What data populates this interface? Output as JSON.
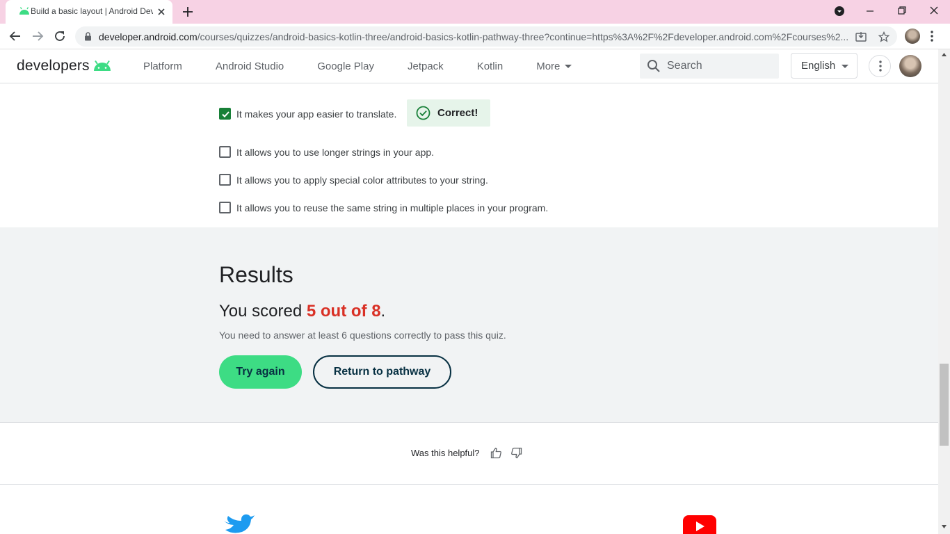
{
  "browser": {
    "tab_title": "Build a basic layout  |  Android Developers",
    "url_host": "developer.android.com",
    "url_path": "/courses/quizzes/android-basics-kotlin-three/android-basics-kotlin-pathway-three?continue=https%3A%2F%2Fdeveloper.android.com%2Fcourses%2..."
  },
  "header": {
    "logo_text": "developers",
    "nav": [
      "Platform",
      "Android Studio",
      "Google Play",
      "Jetpack",
      "Kotlin",
      "More"
    ],
    "search_placeholder": "Search",
    "language": "English"
  },
  "quiz": {
    "options": [
      {
        "label": "It makes your app easier to translate.",
        "checked": true
      },
      {
        "label": "It allows you to use longer strings in your app.",
        "checked": false
      },
      {
        "label": "It allows you to apply special color attributes to your string.",
        "checked": false
      },
      {
        "label": "It allows you to reuse the same string in multiple places in your program.",
        "checked": false
      }
    ],
    "feedback": "Correct!"
  },
  "results": {
    "title": "Results",
    "score_prefix": "You scored ",
    "score_value": "5 out of 8",
    "score_suffix": ".",
    "pass_text": "You need to answer at least 6 questions correctly to pass this quiz.",
    "try_again": "Try again",
    "return_pathway": "Return to pathway"
  },
  "feedback": {
    "label": "Was this helpful?"
  },
  "colors": {
    "tab_strip": "#f7d2e4",
    "android_green": "#3ddc84",
    "correct_green": "#188038",
    "score_red": "#d93025",
    "navy": "#073042"
  },
  "icons": [
    "android-favicon-icon",
    "close-icon",
    "plus-icon",
    "back-arrow-icon",
    "forward-arrow-icon",
    "reload-icon",
    "lock-icon",
    "install-icon",
    "star-icon",
    "more-vert-icon",
    "search-icon",
    "check-circle-icon",
    "thumb-up-icon",
    "thumb-down-icon",
    "twitter-icon",
    "youtube-icon"
  ]
}
